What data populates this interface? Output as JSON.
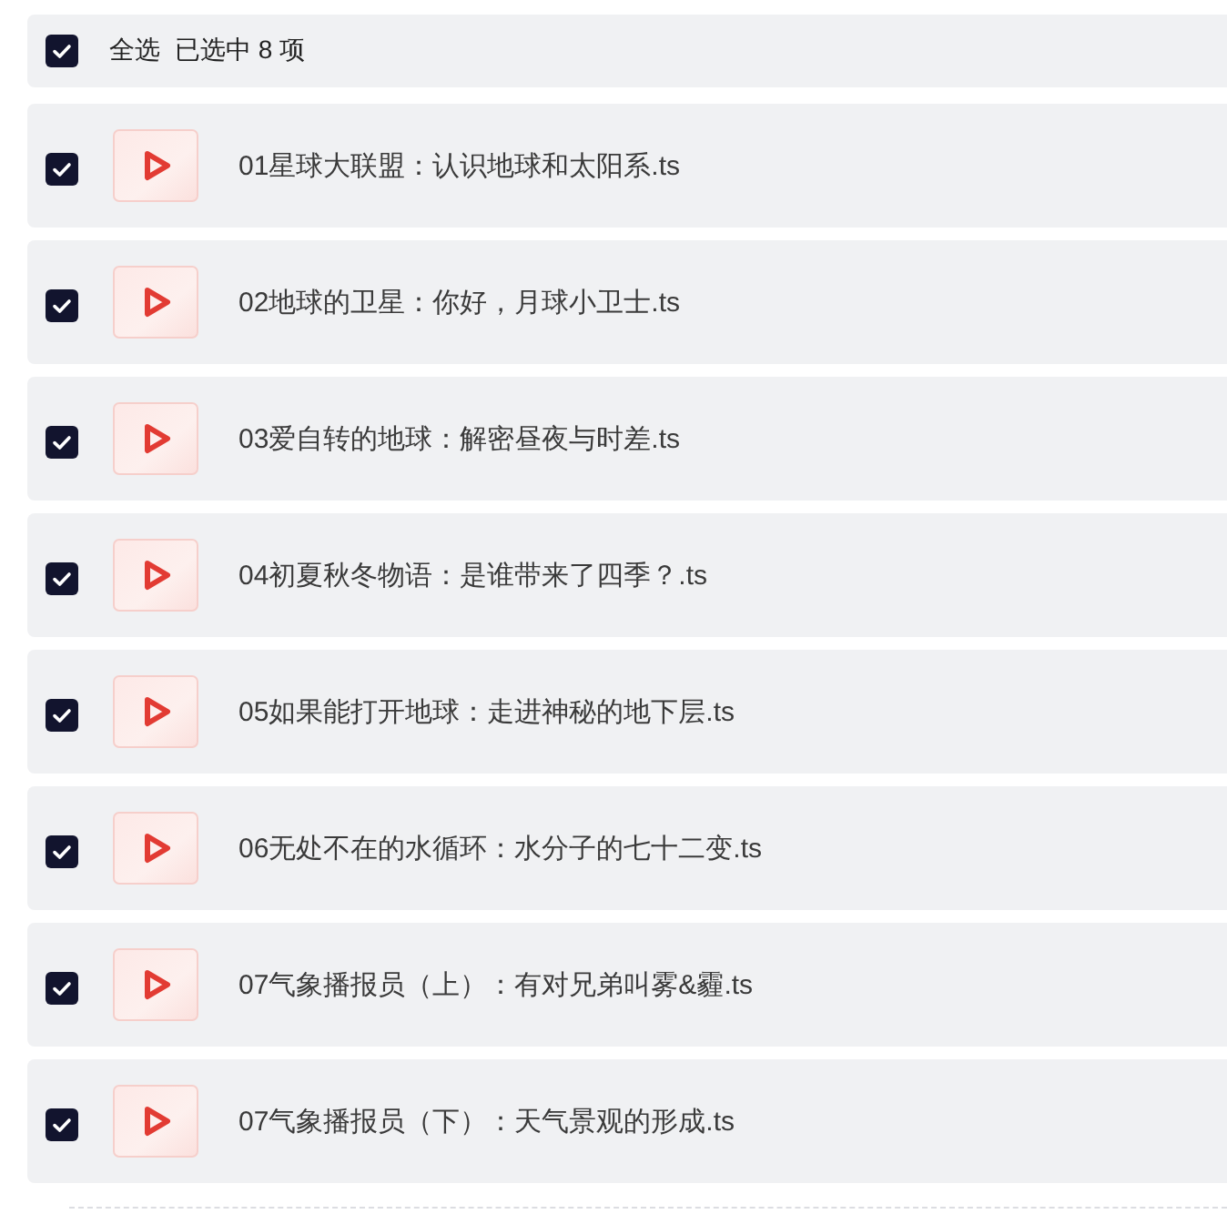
{
  "header": {
    "checked": true,
    "label": "全选",
    "summary": "已选中 8 项"
  },
  "files": [
    {
      "name": "01星球大联盟：认识地球和太阳系.ts",
      "checked": true
    },
    {
      "name": "02地球的卫星：你好，月球小卫士.ts",
      "checked": true
    },
    {
      "name": "03爱自转的地球：解密昼夜与时差.ts",
      "checked": true
    },
    {
      "name": "04初夏秋冬物语：是谁带来了四季？.ts",
      "checked": true
    },
    {
      "name": "05如果能打开地球：走进神秘的地下层.ts",
      "checked": true
    },
    {
      "name": "06无处不在的水循环：水分子的七十二变.ts",
      "checked": true
    },
    {
      "name": "07气象播报员（上）：有对兄弟叫雾&霾.ts",
      "checked": true
    },
    {
      "name": "07气象播报员（下）：天气景观的形成.ts",
      "checked": true
    }
  ]
}
